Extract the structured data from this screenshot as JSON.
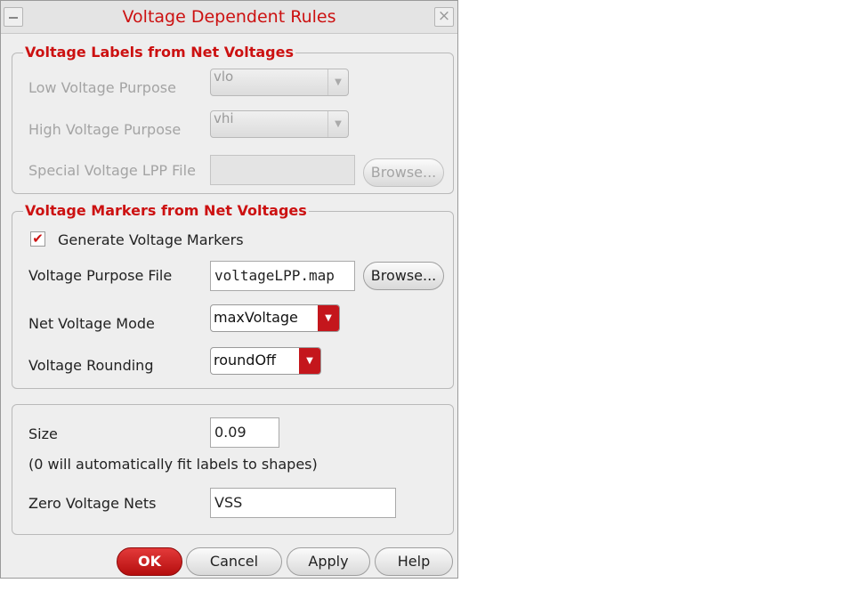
{
  "window": {
    "title": "Voltage Dependent Rules"
  },
  "labels_group": {
    "legend": "Voltage Labels from Net Voltages",
    "low_label": "Low Voltage Purpose",
    "low_value": "vlo",
    "high_label": "High Voltage Purpose",
    "high_value": "vhi",
    "special_label": "Special Voltage LPP File",
    "special_value": "",
    "browse_label": "Browse..."
  },
  "markers_group": {
    "legend": "Voltage Markers from Net Voltages",
    "generate_label": "Generate Voltage Markers",
    "generate_checked": true,
    "purpose_file_label": "Voltage Purpose File",
    "purpose_file_value": "voltageLPP.map",
    "browse_label": "Browse...",
    "mode_label": "Net Voltage Mode",
    "mode_value": "maxVoltage",
    "rounding_label": "Voltage Rounding",
    "rounding_value": "roundOff"
  },
  "size_group": {
    "size_label": "Size",
    "size_value": "0.09",
    "size_note": "(0 will automatically fit labels to shapes)",
    "zero_label": "Zero Voltage Nets",
    "zero_value": "VSS"
  },
  "buttons": {
    "ok": "OK",
    "cancel": "Cancel",
    "apply": "Apply",
    "help": "Help"
  },
  "colors": {
    "accent": "#cc1111",
    "dropdown_arrow": "#c4161c"
  }
}
